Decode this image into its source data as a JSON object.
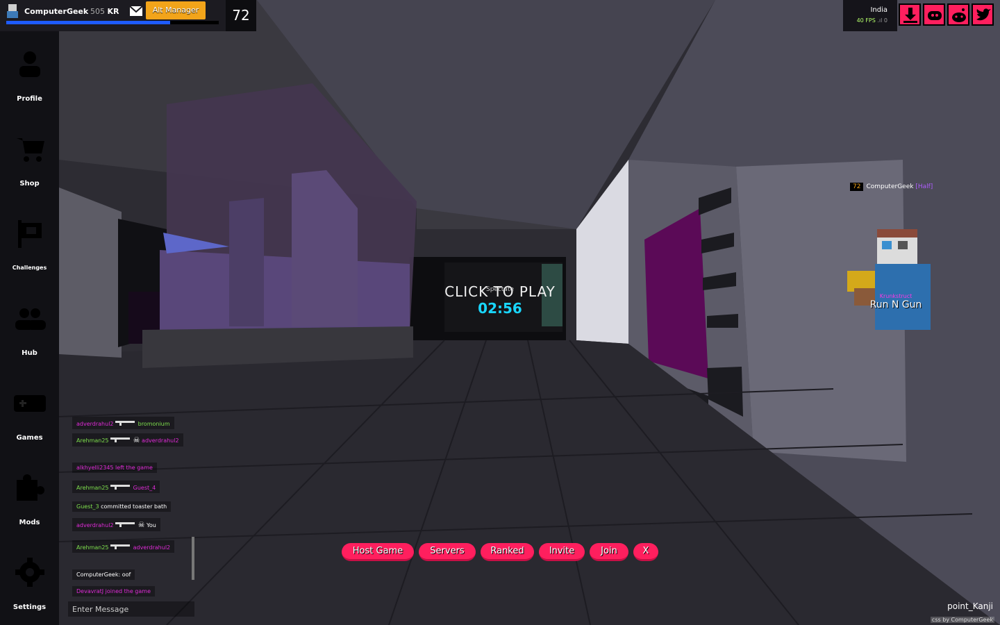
{
  "header": {
    "username": "ComputerGeek",
    "kr_amount": "505",
    "kr_label": "KR",
    "alt_manager_label": "Alt Manager",
    "level": "72",
    "xp_progress": 0.77
  },
  "sidebar": {
    "items": [
      {
        "label": "Profile",
        "icon": "profile-icon"
      },
      {
        "label": "Shop",
        "icon": "cart-icon"
      },
      {
        "label": "Challenges",
        "icon": "flag-icon"
      },
      {
        "label": "Hub",
        "icon": "users-icon"
      },
      {
        "label": "Games",
        "icon": "gamepad-icon"
      },
      {
        "label": "Mods",
        "icon": "puzzle-icon"
      },
      {
        "label": "Settings",
        "icon": "gear-icon"
      }
    ]
  },
  "server": {
    "region": "India",
    "fps": "40 FPS",
    "ping": "0"
  },
  "social": [
    {
      "icon": "download-icon"
    },
    {
      "icon": "discord-icon"
    },
    {
      "icon": "reddit-icon"
    },
    {
      "icon": "twitter-icon"
    }
  ],
  "center": {
    "click_to_play": "CLICK TO PLAY",
    "spectate": "Spectate",
    "timer": "02:56"
  },
  "player": {
    "level": "72",
    "name": "ComputerGeek",
    "class": "[Half]",
    "clan": "Krunkstruct",
    "weapon": "Run N Gun"
  },
  "chat": {
    "messages": [
      {
        "type": "kill",
        "killer": "adverdrahul2",
        "victim": "bromonium"
      },
      {
        "type": "kill",
        "killer": "Arehman25",
        "victim": "adverdrahul2"
      },
      {
        "type": "notice",
        "text": "alkhyelli2345 left the game"
      },
      {
        "type": "kill",
        "killer": "Arehman25",
        "victim": "Guest_4"
      },
      {
        "type": "death",
        "name": "Guest_3",
        "text": "committed toaster bath"
      },
      {
        "type": "kill",
        "killer": "adverdrahul2",
        "victim": "You"
      },
      {
        "type": "kill",
        "killer": "Arehman25",
        "victim": "adverdrahul2"
      },
      {
        "type": "chat",
        "name": "ComputerGeek:",
        "text": "oof"
      },
      {
        "type": "notice",
        "text": "DevavratJ joined the game"
      }
    ],
    "input_placeholder": "Enter Message"
  },
  "buttons": [
    "Host Game",
    "Servers",
    "Ranked",
    "Invite",
    "Join",
    "X"
  ],
  "map_name": "point_Kanji",
  "credit": "css by ComputerGeek",
  "colors": {
    "accent": "#ff1f5e",
    "alt_manager": "#f2a41a",
    "timer": "#19d6ff",
    "xp": "#1e5bff"
  }
}
